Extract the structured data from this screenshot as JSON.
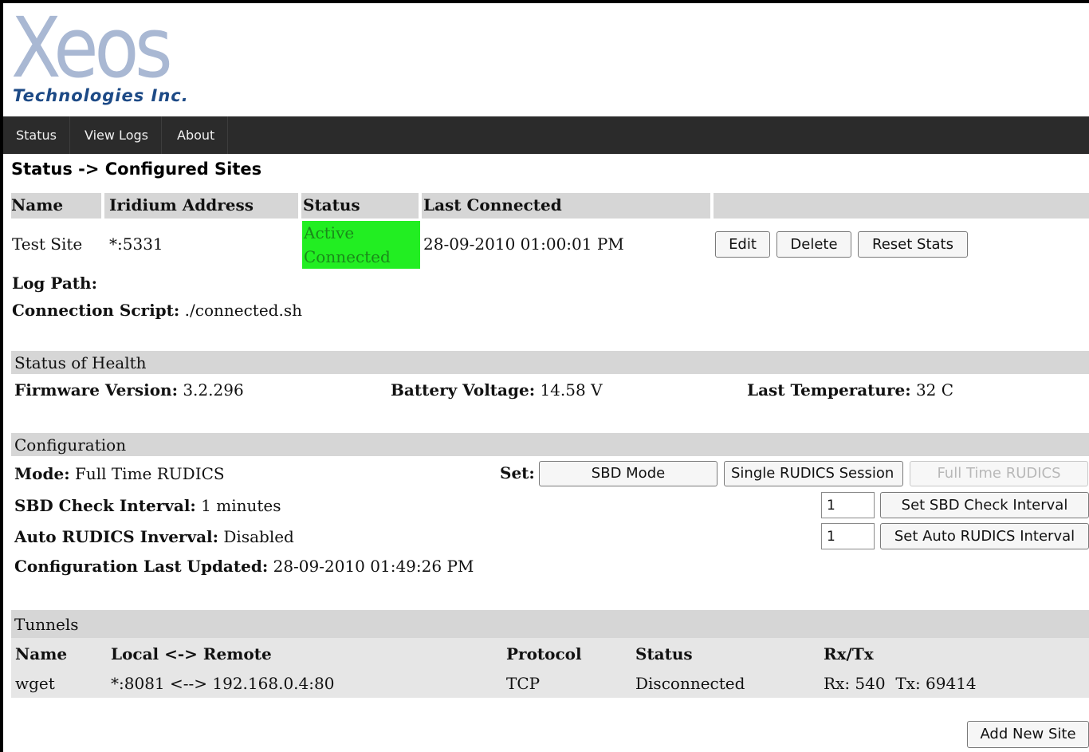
{
  "logo": {
    "main": "Xeos",
    "sub": "Technologies Inc."
  },
  "nav": [
    "Status",
    "View Logs",
    "About"
  ],
  "page_title": "Status -> Configured Sites",
  "sites_table": {
    "headers": [
      "Name",
      "Iridium Address",
      "Status",
      "Last Connected"
    ],
    "row": {
      "name": "Test Site",
      "address": "*:5331",
      "status_line1": "Active",
      "status_line2": "Connected",
      "last_connected": "28-09-2010 01:00:01 PM"
    },
    "buttons": [
      "Edit",
      "Delete",
      "Reset Stats"
    ]
  },
  "log_path": {
    "label": "Log Path:",
    "value": ""
  },
  "connection_script": {
    "label": "Connection Script:",
    "value": "./connected.sh"
  },
  "health": {
    "title": "Status of Health",
    "firmware_label": "Firmware Version:",
    "firmware": "3.2.296",
    "battery_label": "Battery Voltage:",
    "battery": "14.58 V",
    "temp_label": "Last Temperature:",
    "temp": "32 C"
  },
  "configuration": {
    "title": "Configuration",
    "mode_label": "Mode:",
    "mode": "Full Time RUDICS",
    "set_label": "Set:",
    "mode_buttons": [
      "SBD Mode",
      "Single RUDICS Session",
      "Full Time RUDICS"
    ],
    "sbd_label": "SBD Check Interval:",
    "sbd_value": "1 minutes",
    "sbd_input": "1",
    "sbd_button": "Set SBD Check Interval",
    "auto_label": "Auto RUDICS Inverval:",
    "auto_value": "Disabled",
    "auto_input": "1",
    "auto_button": "Set Auto RUDICS Interval",
    "updated_label": "Configuration Last Updated:",
    "updated_value": "28-09-2010 01:49:26 PM"
  },
  "tunnels": {
    "title": "Tunnels",
    "headers": [
      "Name",
      "Local <-> Remote",
      "Protocol",
      "Status",
      "Rx/Tx"
    ],
    "row": {
      "name": "wget",
      "mapping": "*:8081 <--> 192.168.0.4:80",
      "protocol": "TCP",
      "status": "Disconnected",
      "rxtx": "Rx: 540  Tx: 69414"
    }
  },
  "add_new_site": "Add New Site",
  "colors": {
    "nav_bg": "#2b2b2b",
    "header_bg": "#d6d6d6",
    "status_connected": "#22ee22",
    "logo_light": "#a9b8d3",
    "logo_dark": "#1d4a86"
  }
}
